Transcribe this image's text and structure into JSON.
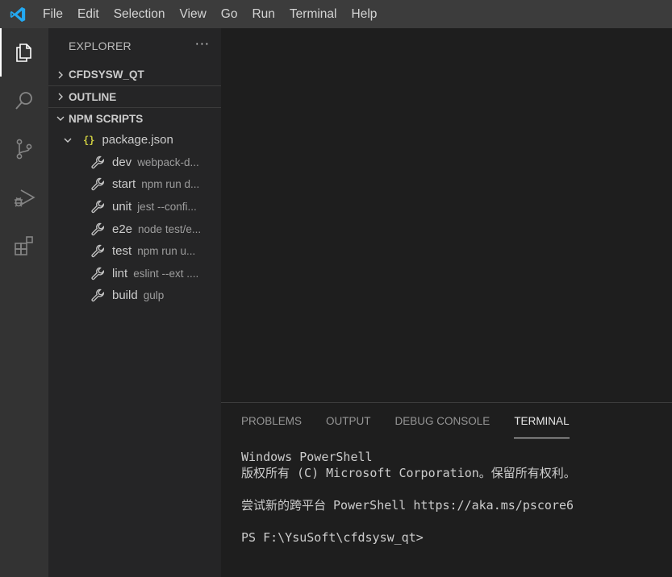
{
  "menu": {
    "items": [
      "File",
      "Edit",
      "Selection",
      "View",
      "Go",
      "Run",
      "Terminal",
      "Help"
    ]
  },
  "activity_bar": {
    "items": [
      "files-icon",
      "search-icon",
      "source-control-icon",
      "run-debug-icon",
      "extensions-icon"
    ]
  },
  "sidebar": {
    "title": "EXPLORER",
    "more": "···",
    "sections": [
      {
        "label": "CFDSYSW_QT",
        "expanded": false
      },
      {
        "label": "OUTLINE",
        "expanded": false
      },
      {
        "label": "NPM SCRIPTS",
        "expanded": true
      }
    ],
    "package": {
      "braces": "{}",
      "label": "package.json"
    },
    "scripts": [
      {
        "name": "dev",
        "command": "webpack-d..."
      },
      {
        "name": "start",
        "command": "npm run d..."
      },
      {
        "name": "unit",
        "command": "jest --confi..."
      },
      {
        "name": "e2e",
        "command": "node test/e..."
      },
      {
        "name": "test",
        "command": "npm run u..."
      },
      {
        "name": "lint",
        "command": "eslint --ext ...."
      },
      {
        "name": "build",
        "command": "gulp"
      }
    ]
  },
  "panel": {
    "tabs": [
      {
        "label": "PROBLEMS",
        "active": false
      },
      {
        "label": "OUTPUT",
        "active": false
      },
      {
        "label": "DEBUG CONSOLE",
        "active": false
      },
      {
        "label": "TERMINAL",
        "active": true
      }
    ],
    "terminal_lines": [
      "Windows PowerShell",
      "版权所有 (C) Microsoft Corporation。保留所有权利。",
      "",
      "尝试新的跨平台 PowerShell https://aka.ms/pscore6",
      "",
      "PS F:\\YsuSoft\\cfdsysw_qt>"
    ]
  },
  "colors": {
    "accent_logo": "#23a9f2",
    "package_braces": "#cbcb41"
  }
}
